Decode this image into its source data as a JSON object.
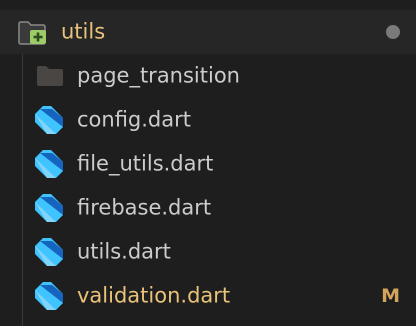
{
  "explorer": {
    "folder": {
      "name": "utils",
      "icon": "folder-open-icon",
      "modified_dot_color": "#7a7a7a",
      "label_color": "#e9c37a"
    },
    "items": [
      {
        "label": "page_transition",
        "icon": "folder-icon",
        "color": "#cccccc"
      },
      {
        "label": "config.dart",
        "icon": "dart-file-icon",
        "color": "#cccccc"
      },
      {
        "label": "file_utils.dart",
        "icon": "dart-file-icon",
        "color": "#cccccc"
      },
      {
        "label": "firebase.dart",
        "icon": "dart-file-icon",
        "color": "#cccccc"
      },
      {
        "label": "utils.dart",
        "icon": "dart-file-icon",
        "color": "#cccccc"
      },
      {
        "label": "validation.dart",
        "icon": "dart-file-icon",
        "color": "#e9c37a",
        "git_status": "M",
        "git_status_color": "#d2a45c"
      }
    ]
  }
}
